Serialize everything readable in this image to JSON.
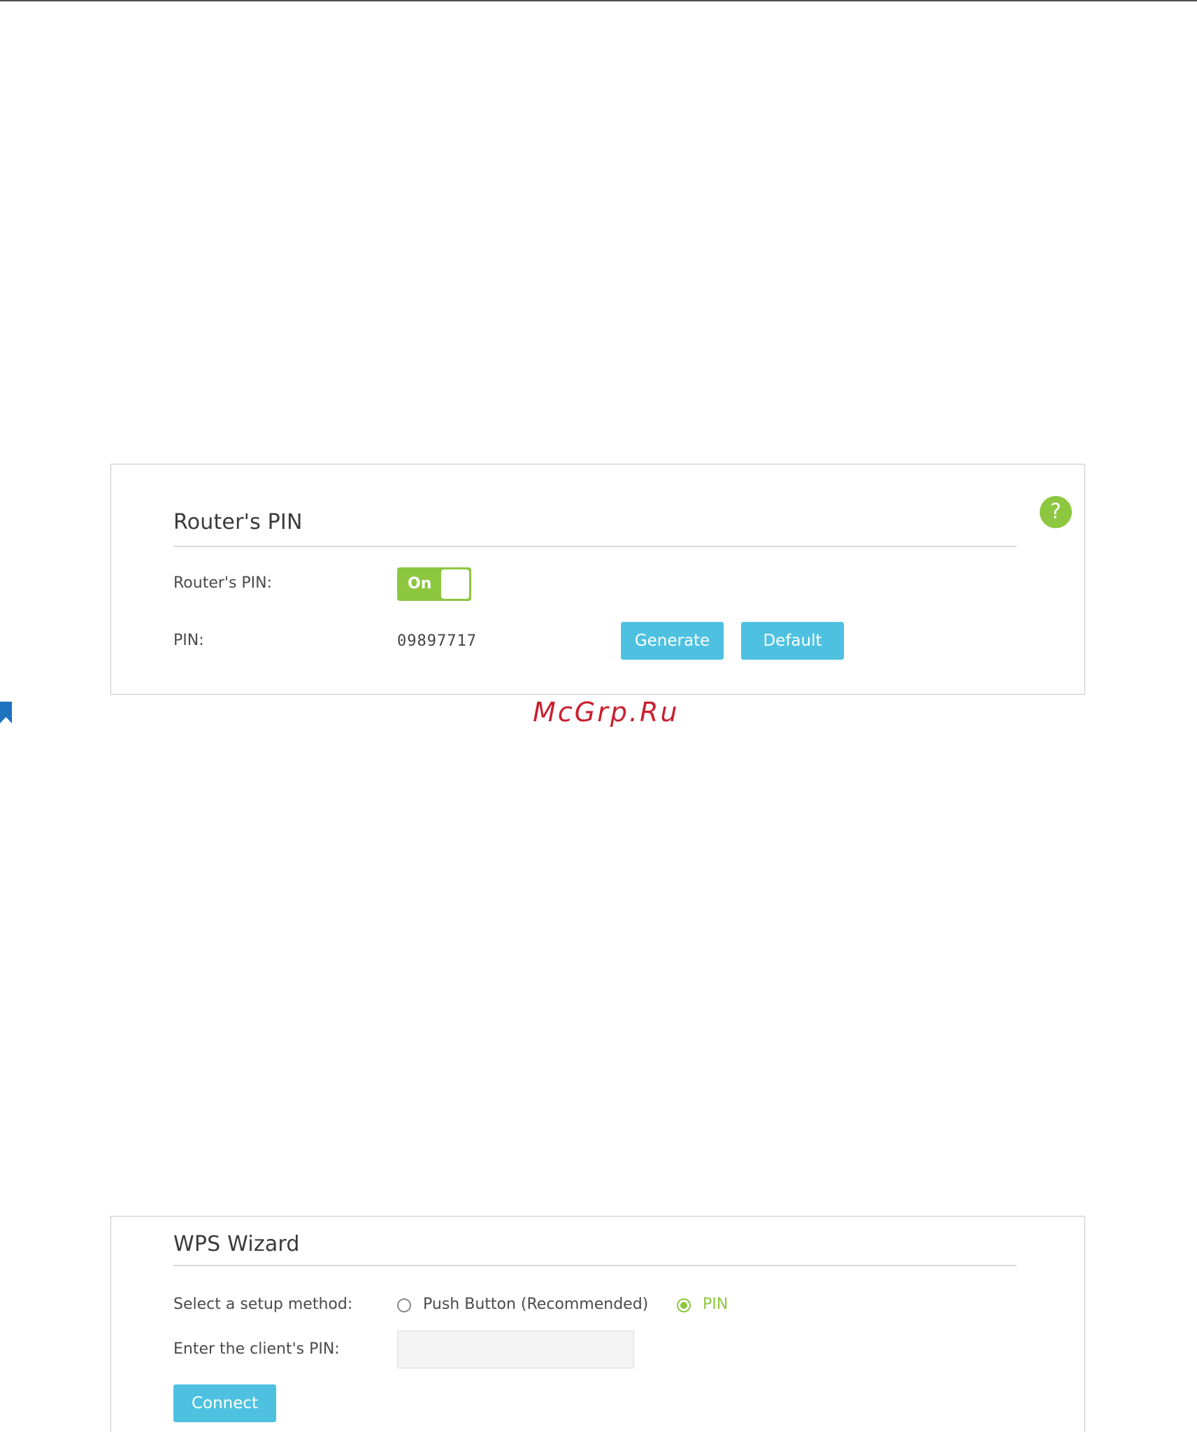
{
  "router_pin_panel": {
    "title": "Router's PIN",
    "help_icon_glyph": "?",
    "toggle_row": {
      "label": "Router's PIN:",
      "toggle_text": "On",
      "toggle_state": "on"
    },
    "pin_row": {
      "label": "PIN:",
      "value": "09897717",
      "generate_label": "Generate",
      "default_label": "Default"
    }
  },
  "wps_wizard_panel": {
    "title": "WPS Wizard",
    "setup_method": {
      "label": "Select a setup method:",
      "options": [
        {
          "label": "Push Button (Recommended)",
          "selected": false
        },
        {
          "label": "PIN",
          "selected": true
        }
      ]
    },
    "client_pin": {
      "label": "Enter the client's PIN:",
      "value": ""
    },
    "connect_label": "Connect"
  },
  "watermark": "McGrp.Ru",
  "icons": {
    "help": "help-circle-icon",
    "bookmark": "bookmark-icon"
  },
  "colors": {
    "accent_green": "#8dc63f",
    "button_blue": "#4ec1e0",
    "watermark_red": "#c8202f",
    "bookmark_blue": "#1e73be"
  }
}
